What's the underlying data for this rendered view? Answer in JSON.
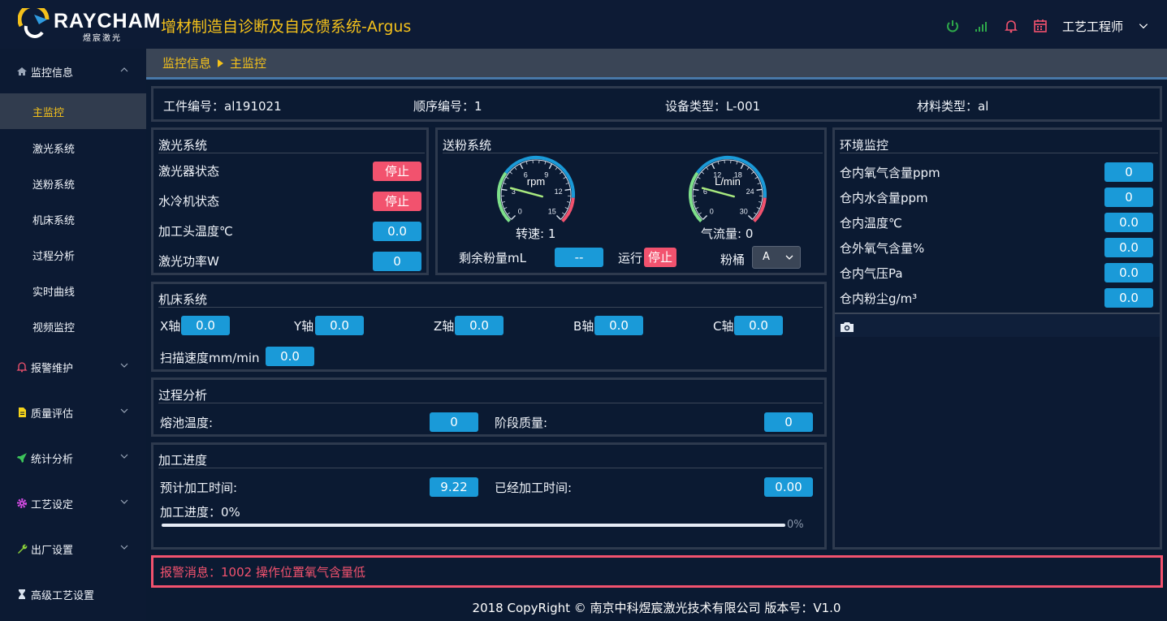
{
  "header": {
    "brand": "RAYCHAM",
    "brand_sub": "煜宸激光",
    "app_title": "增材制造自诊断及自反馈系统-Argus",
    "user": "工艺工程师",
    "icons": [
      "power-icon",
      "signal-icon",
      "bell-icon",
      "calendar-icon",
      "chevron-down-icon"
    ]
  },
  "sidebar": {
    "groups": [
      {
        "label": "监控信息",
        "icon": "home-icon",
        "color": "#9aa6b8"
      },
      {
        "label": "报警维护",
        "icon": "bell-icon",
        "color": "#f2526e"
      },
      {
        "label": "质量评估",
        "icon": "document-icon",
        "color": "#f4d21b"
      },
      {
        "label": "统计分析",
        "icon": "rocket-icon",
        "color": "#3cc35a"
      },
      {
        "label": "工艺设定",
        "icon": "gear-icon",
        "color": "#d04be0"
      },
      {
        "label": "出厂设置",
        "icon": "wrench-icon",
        "color": "#8ed43a"
      },
      {
        "label": "高级工艺设置",
        "icon": "hourglass-icon",
        "color": "#d9e2ee"
      }
    ],
    "items": [
      "主监控",
      "激光系统",
      "送粉系统",
      "机床系统",
      "过程分析",
      "实时曲线",
      "视频监控"
    ]
  },
  "breadcrumb": {
    "parent": "监控信息",
    "current": "主监控"
  },
  "info": {
    "part_no_label": "工件编号：",
    "part_no": "al191021",
    "seq_label": "顺序编号：",
    "seq": "1",
    "device_label": "设备类型：",
    "device": "L-001",
    "material_label": "材料类型：",
    "material": "al"
  },
  "laser": {
    "title": "激光系统",
    "laser_state_label": "激光器状态",
    "laser_state": "停止",
    "chiller_label": "水冷机状态",
    "chiller_state": "停止",
    "head_temp_label": "加工头温度℃",
    "head_temp": "0.0",
    "power_label": "激光功率W",
    "power": "0"
  },
  "powder": {
    "title": "送粉系统",
    "gauge1": {
      "unit": "rpm",
      "ticks": [
        "0",
        "3",
        "6",
        "9",
        "12",
        "15"
      ],
      "value": 0,
      "max": 15,
      "caption": "转速: 1"
    },
    "gauge2": {
      "unit": "L/min",
      "ticks": [
        "0",
        "6",
        "12",
        "18",
        "24",
        "30"
      ],
      "value": 0,
      "max": 30,
      "caption": "气流量: 0"
    },
    "remain_label": "剩余粉量mL",
    "remain": "--",
    "run_label": "运行",
    "run_state": "停止",
    "bucket_label": "粉桶",
    "bucket": "A"
  },
  "environment": {
    "title": "环境监控",
    "rows": [
      {
        "label": "仓内氧气含量ppm",
        "value": "0"
      },
      {
        "label": "仓内水含量ppm",
        "value": "0"
      },
      {
        "label": "仓内温度℃",
        "value": "0.0"
      },
      {
        "label": "仓外氧气含量%",
        "value": "0.0"
      },
      {
        "label": "仓内气压Pa",
        "value": "0.0"
      },
      {
        "label": "仓内粉尘g/m³",
        "value": "0.0"
      }
    ],
    "camera_icon": "camera-icon"
  },
  "machine": {
    "title": "机床系统",
    "axes": [
      {
        "label": "X轴",
        "value": "0.0"
      },
      {
        "label": "Y轴",
        "value": "0.0"
      },
      {
        "label": "Z轴",
        "value": "0.0"
      },
      {
        "label": "B轴",
        "value": "0.0"
      },
      {
        "label": "C轴",
        "value": "0.0"
      }
    ],
    "scan_label": "扫描速度mm/min",
    "scan": "0.0"
  },
  "process": {
    "title": "过程分析",
    "pool_label": "熔池温度:",
    "pool": "0",
    "quality_label": "阶段质量:",
    "quality": "0"
  },
  "progress": {
    "title": "加工进度",
    "est_label": "预计加工时间:",
    "est": "9.22",
    "elapsed_label": "已经加工时间:",
    "elapsed": "0.00",
    "progress_label": "加工进度：",
    "progress_text": "0%",
    "bar_text": "0%",
    "fraction": 0
  },
  "alarm": {
    "label": "报警消息：",
    "message": "1002 操作位置氧气含量低"
  },
  "footer": {
    "text": "2018 CopyRight © 南京中科煜宸激光技术有限公司 版本号：V1.0"
  },
  "colors": {
    "accent": "#f4c11b",
    "value": "#1a9ad8",
    "stop": "#f2526e",
    "success": "#2ea84a"
  }
}
